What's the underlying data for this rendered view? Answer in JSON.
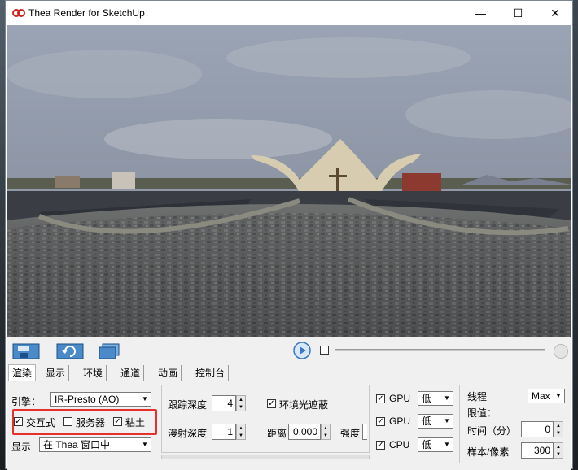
{
  "window": {
    "title": "Thea Render for SketchUp"
  },
  "titlebar_buttons": [
    "—",
    "☐",
    "✕"
  ],
  "icons": [
    "thea-logo-icon",
    "save-render-icon",
    "refresh-render-icon",
    "render-region-icon",
    "play-icon"
  ],
  "tabs": [
    "渲染",
    "显示",
    "环境",
    "通道",
    "动画",
    "控制台"
  ],
  "engine": {
    "label": "引擎：",
    "value": "IR-Presto (AO)"
  },
  "options": {
    "interactive": "交互式",
    "server": "服务器",
    "clay": "粘土"
  },
  "display": {
    "label": "显示",
    "value": "在 Thea 窗口中"
  },
  "trace": {
    "trace_depth_label": "跟踪深度",
    "trace_depth": "4",
    "diffuse_depth_label": "漫射深度",
    "diffuse_depth": "1"
  },
  "ao": {
    "label": "环境光遮蔽",
    "distance_label": "距离",
    "distance": "0.000",
    "intensity_label": "强度"
  },
  "devices": [
    {
      "label": "GPU",
      "value": "低"
    },
    {
      "label": "GPU",
      "value": "低"
    },
    {
      "label": "CPU",
      "value": "低"
    }
  ],
  "limits": {
    "threads_label": "线程",
    "threads": "Max",
    "limit_label": "限值：",
    "time_label": "时间（分）",
    "time": "0",
    "samples_label": "样本/像素",
    "samples": "300"
  }
}
